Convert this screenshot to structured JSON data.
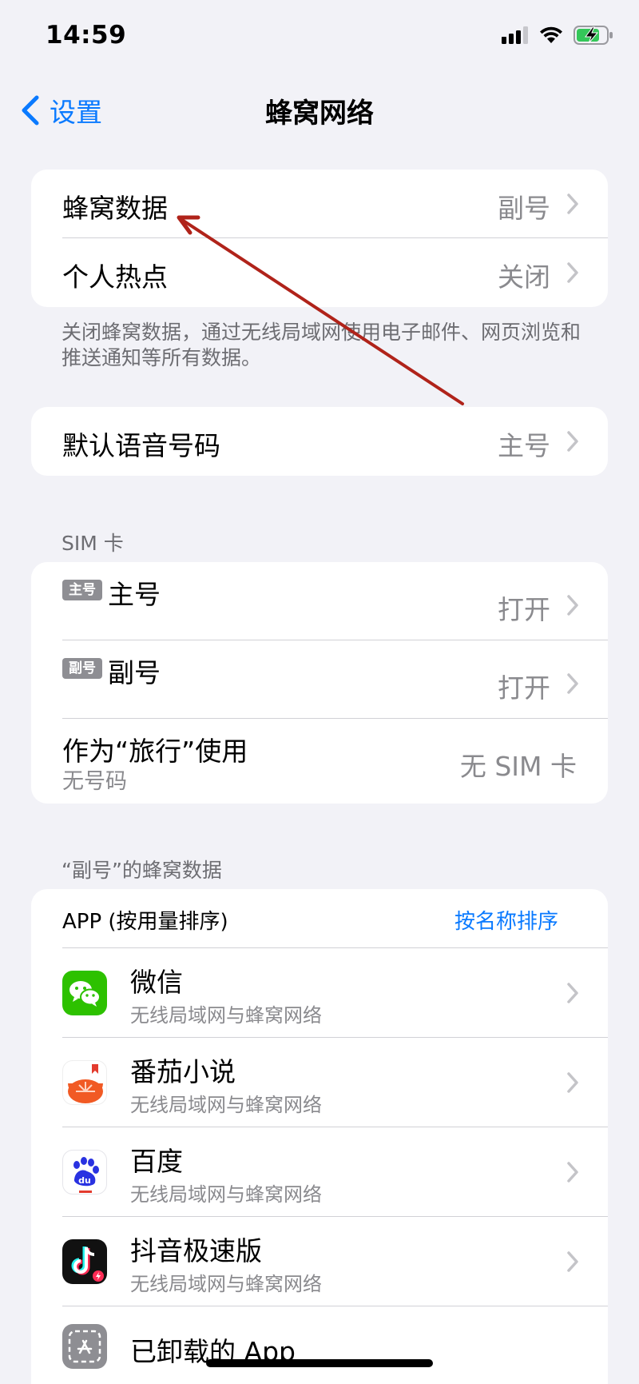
{
  "status": {
    "time": "14:59"
  },
  "nav": {
    "back_label": "设置",
    "title": "蜂窝网络"
  },
  "group1": {
    "rows": [
      {
        "label": "蜂窝数据",
        "value": "副号"
      },
      {
        "label": "个人热点",
        "value": "关闭"
      }
    ],
    "footer": "关闭蜂窝数据，通过无线局域网使用电子邮件、网页浏览和推送通知等所有数据。"
  },
  "group2": {
    "rows": [
      {
        "label": "默认语音号码",
        "value": "主号"
      }
    ]
  },
  "sim": {
    "header": "SIM 卡",
    "rows": [
      {
        "badge": "主号",
        "label": "主号",
        "value": "打开"
      },
      {
        "badge": "副号",
        "label": "副号",
        "value": "打开"
      },
      {
        "label": "作为“旅行”使用",
        "sub": "无号码",
        "value": "无 SIM 卡"
      }
    ]
  },
  "apps": {
    "header": "“副号”的蜂窝数据",
    "sort_label": "APP (按用量排序)",
    "sort_button": "按名称排序",
    "items": [
      {
        "name": "微信",
        "sub": "无线局域网与蜂窝网络",
        "icon": "wechat-icon"
      },
      {
        "name": "番茄小说",
        "sub": "无线局域网与蜂窝网络",
        "icon": "fanqie-icon"
      },
      {
        "name": "百度",
        "sub": "无线局域网与蜂窝网络",
        "icon": "baidu-icon"
      },
      {
        "name": "抖音极速版",
        "sub": "无线局域网与蜂窝网络",
        "icon": "douyin-icon"
      },
      {
        "name": "已卸载的 App",
        "icon": "uninstalled-app-icon"
      }
    ]
  },
  "colors": {
    "accent": "#0a7aff",
    "background": "#f2f2f7",
    "annotation": "#b0231a"
  }
}
